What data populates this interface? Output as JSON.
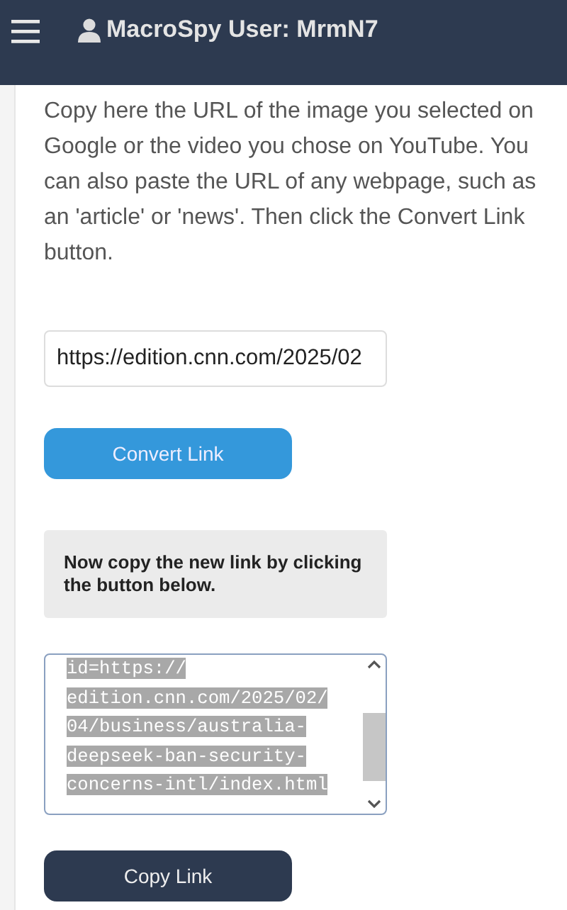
{
  "header": {
    "title": "MacroSpy User: MrmN7"
  },
  "instructions": "Copy here the URL of the image you selected on Google or the video you chose on YouTube. You can also paste the URL of any webpage, such as an 'article' or 'news'. Then click the Convert Link button.",
  "url_field": {
    "value": "https://edition.cnn.com/2025/02"
  },
  "convert_button": "Convert Link",
  "notice": "Now copy the new link by clicking the button below.",
  "result_field": {
    "text_selected": true,
    "lines": [
      "id=https://",
      "edition.cnn.com/2025/02/",
      "04/business/australia-",
      "deepseek-ban-security-",
      "concerns-intl/index.html"
    ]
  },
  "copy_button": "Copy Link"
}
